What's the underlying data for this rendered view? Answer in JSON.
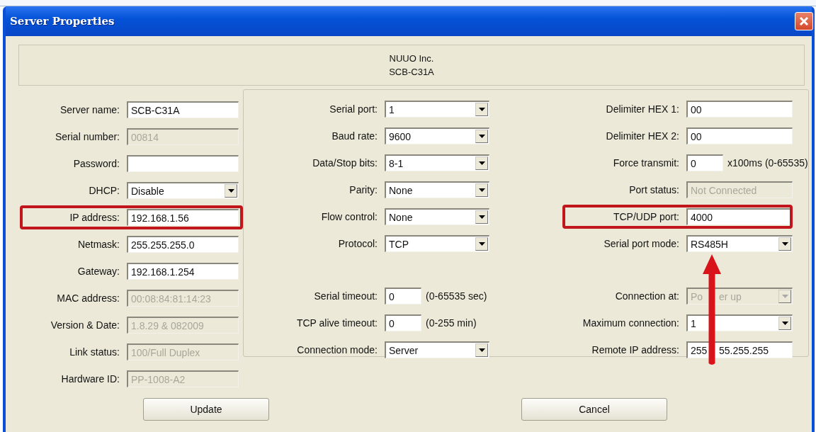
{
  "window": {
    "title": "Server Properties"
  },
  "header": [
    "NUUO Inc.",
    "SCB-C31A"
  ],
  "device": [
    {
      "label": "Server name:",
      "value": "SCB-C31A",
      "kind": "text",
      "disabled": false,
      "highlighted": false
    },
    {
      "label": "Serial number:",
      "value": "00814",
      "kind": "text",
      "disabled": true,
      "highlighted": false
    },
    {
      "label": "Password:",
      "kind": "text",
      "disabled": false,
      "highlighted": false
    },
    {
      "label": "DHCP:",
      "value": "Disable",
      "kind": "combo",
      "disabled": false,
      "highlighted": false
    },
    {
      "label": "IP address:",
      "value": "192.168.1.56",
      "kind": "text",
      "disabled": false,
      "highlighted": true
    },
    {
      "label": "Netmask:",
      "value": "255.255.255.0",
      "kind": "text",
      "disabled": false,
      "highlighted": false
    },
    {
      "label": "Gateway:",
      "value": "192.168.1.254",
      "kind": "text",
      "disabled": false,
      "highlighted": false
    },
    {
      "label": "MAC address:",
      "value": "00:08:84:81:14:23",
      "kind": "text",
      "disabled": true,
      "highlighted": false
    },
    {
      "label": "Version & Date:",
      "value": "1.8.29 & 082009",
      "kind": "text",
      "disabled": true,
      "highlighted": false
    },
    {
      "label": "Link status:",
      "value": "100/Full Duplex",
      "kind": "text",
      "disabled": true,
      "highlighted": false
    },
    {
      "label": "Hardware ID:",
      "value": "PP-1008-A2",
      "kind": "text",
      "disabled": true,
      "highlighted": false
    }
  ],
  "serial": [
    {
      "label": "Serial port:",
      "value": "1",
      "kind": "combo",
      "disabled": false,
      "highlighted": false
    },
    {
      "label": "Baud rate:",
      "value": "9600",
      "kind": "combo",
      "disabled": false,
      "highlighted": false
    },
    {
      "label": "Data/Stop bits:",
      "value": "8-1",
      "kind": "combo",
      "disabled": false,
      "highlighted": false
    },
    {
      "label": "Parity:",
      "value": "None",
      "kind": "combo",
      "disabled": false,
      "highlighted": false
    },
    {
      "label": "Flow control:",
      "value": "None",
      "kind": "combo",
      "disabled": false,
      "highlighted": false
    },
    {
      "label": "Protocol:",
      "value": "TCP",
      "kind": "combo",
      "disabled": false,
      "highlighted": false
    }
  ],
  "timeouts": [
    {
      "label": "Serial timeout:",
      "value": "0",
      "unit": "(0-65535 sec)",
      "kind": "text",
      "disabled": false,
      "highlighted": false
    },
    {
      "label": "TCP alive timeout:",
      "value": "0",
      "unit": "(0-255 min)",
      "kind": "text",
      "disabled": false,
      "highlighted": false
    },
    {
      "label": "Connection mode:",
      "value": "Server",
      "kind": "combo",
      "disabled": false,
      "highlighted": false
    }
  ],
  "port": [
    {
      "label": "Delimiter HEX 1:",
      "value": "00",
      "kind": "text",
      "disabled": false,
      "highlighted": false,
      "arrow": false
    },
    {
      "label": "Delimiter HEX 2:",
      "value": "00",
      "kind": "text",
      "disabled": false,
      "highlighted": false,
      "arrow": false
    },
    {
      "label": "Force transmit:",
      "value": "0",
      "unit": "x100ms (0-65535)",
      "kind": "text",
      "disabled": false,
      "highlighted": false,
      "arrow": false
    },
    {
      "label": "Port status:",
      "value": "Not Connected",
      "kind": "text",
      "disabled": true,
      "highlighted": false,
      "arrow": false
    },
    {
      "label": "TCP/UDP port:",
      "value": "4000",
      "kind": "text",
      "disabled": false,
      "highlighted": true,
      "arrow": false
    },
    {
      "label": "Serial port mode:",
      "value": "RS485H",
      "kind": "combo",
      "disabled": false,
      "highlighted": false,
      "arrow": true
    }
  ],
  "connection": [
    {
      "label": "Connection at:",
      "value_parts": [
        "Po",
        "er up"
      ],
      "kind": "combo",
      "disabled": true,
      "highlighted": false,
      "arrow": false
    },
    {
      "label": "Maximum connection:",
      "value": "1",
      "kind": "combo",
      "disabled": false,
      "highlighted": false,
      "arrow": false
    },
    {
      "label": "Remote IP address:",
      "value_parts": [
        "255",
        "55.255.255"
      ],
      "kind": "text",
      "disabled": false,
      "highlighted": false,
      "arrow": false
    }
  ],
  "buttons": [
    "Update",
    "Cancel"
  ]
}
